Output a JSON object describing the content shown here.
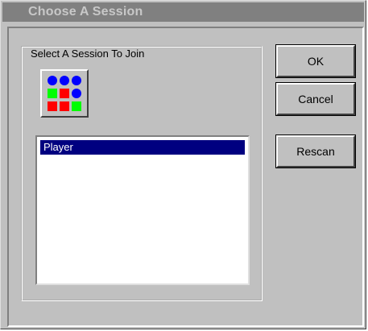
{
  "window": {
    "title": "Choose A Session"
  },
  "group": {
    "label": "Select A Session To Join"
  },
  "icon": {
    "name": "session-grid-icon"
  },
  "sessions": [
    {
      "label": "Player",
      "selected": true
    }
  ],
  "buttons": {
    "ok": "OK",
    "cancel": "Cancel",
    "rescan": "Rescan"
  },
  "colors": {
    "face": "#c0c0c0",
    "title_bg": "#808080",
    "selection": "#000080",
    "icon_blue": "#0000ff",
    "icon_red": "#ff0000",
    "icon_green": "#00ff00"
  }
}
